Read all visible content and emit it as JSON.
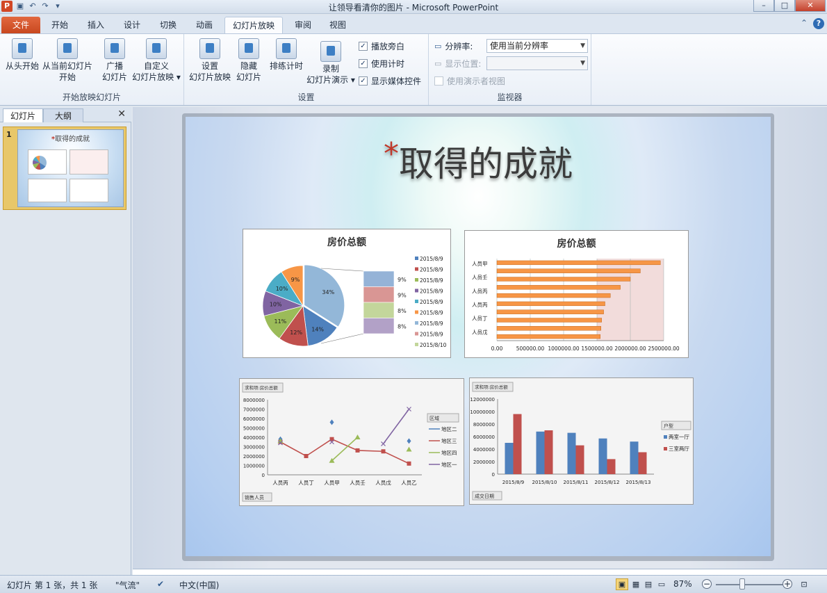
{
  "window": {
    "title": "让领导看清你的图片 - Microsoft PowerPoint"
  },
  "tabs": [
    "文件",
    "开始",
    "插入",
    "设计",
    "切换",
    "动画",
    "幻灯片放映",
    "审阅",
    "视图"
  ],
  "ribbon": {
    "group1": {
      "label": "开始放映幻灯片",
      "from_start": "从头开始",
      "from_current_1": "从当前幻灯片",
      "from_current_2": "开始",
      "broadcast_1": "广播",
      "broadcast_2": "幻灯片",
      "custom_1": "自定义",
      "custom_2": "幻灯片放映"
    },
    "group2": {
      "label": "设置",
      "setup_1": "设置",
      "setup_2": "幻灯片放映",
      "hide_1": "隐藏",
      "hide_2": "幻灯片",
      "rehearse": "排练计时",
      "record_1": "录制",
      "record_2": "幻灯片演示",
      "play_narration": "播放旁白",
      "use_timings": "使用计时",
      "show_media": "显示媒体控件"
    },
    "group3": {
      "label": "监视器",
      "resolution_label": "分辨率:",
      "resolution_value": "使用当前分辨率",
      "show_on_label": "显示位置:",
      "presenter_view": "使用演示者视图"
    }
  },
  "leftpane": {
    "tab_slides": "幻灯片",
    "tab_outline": "大纲",
    "thumb_number": "1",
    "thumb_title": "取得的成就"
  },
  "slide": {
    "title": "取得的成就",
    "asterisk": "*"
  },
  "chart_data": [
    {
      "type": "pie",
      "title": "房价总额",
      "slices": [
        {
          "label": "34%",
          "value": 34
        },
        {
          "label": "14%",
          "value": 14
        },
        {
          "label": "12%",
          "value": 12
        },
        {
          "label": "11%",
          "value": 11
        },
        {
          "label": "10%",
          "value": 10
        },
        {
          "label": "10%",
          "value": 10
        },
        {
          "label": "9%",
          "value": 9
        }
      ],
      "sub_bar": [
        "9%",
        "9%",
        "8%",
        "8%"
      ],
      "legend": [
        "2015/8/9",
        "2015/8/9",
        "2015/8/9",
        "2015/8/9",
        "2015/8/9",
        "2015/8/9",
        "2015/8/9",
        "2015/8/9",
        "2015/8/10"
      ],
      "colors": [
        "#4f81bd",
        "#c0504d",
        "#9bbb59",
        "#8064a2",
        "#4bacc6",
        "#f79646",
        "#93b7d8",
        "#d99694",
        "#c3d69b"
      ]
    },
    {
      "type": "bar",
      "title": "房价总额",
      "categories": [
        "人员甲",
        "人员壬",
        "人员丙",
        "人员丙",
        "人员丁",
        "人员戊"
      ],
      "values": [
        1550000,
        1560000,
        1570000,
        1600000,
        1620000,
        1700000,
        1850000,
        2000000,
        2150000,
        2450000
      ],
      "xticks": [
        "0.00",
        "500000.00",
        "1000000.00",
        "1500000.00",
        "2000000.00",
        "2500000.00"
      ],
      "xlim": [
        0,
        2500000
      ]
    },
    {
      "type": "line",
      "field_label": "求和项:房价总额",
      "categories": [
        "人员丙",
        "人员丁",
        "人员甲",
        "人员壬",
        "人员戊",
        "人员乙"
      ],
      "yticks": [
        "0",
        "1000000",
        "2000000",
        "3000000",
        "4000000",
        "5000000",
        "6000000",
        "7000000",
        "8000000"
      ],
      "ylim": [
        0,
        8000000
      ],
      "legend_title": "区域",
      "series": [
        {
          "name": "地区二",
          "values": [
            3800000,
            null,
            5600000,
            null,
            null,
            3600000
          ]
        },
        {
          "name": "地区三",
          "values": [
            3500000,
            2000000,
            3800000,
            2600000,
            2500000,
            1200000
          ]
        },
        {
          "name": "地区四",
          "values": [
            3600000,
            null,
            1500000,
            4000000,
            null,
            2700000
          ]
        },
        {
          "name": "地区一",
          "values": [
            3400000,
            null,
            3500000,
            null,
            3300000,
            7000000
          ]
        }
      ],
      "filter_label": "销售人员"
    },
    {
      "type": "bar",
      "field_label": "求和项:房价总额",
      "categories": [
        "2015/8/9",
        "2015/8/10",
        "2015/8/11",
        "2015/8/12",
        "2015/8/13"
      ],
      "yticks": [
        "0",
        "2000000",
        "4000000",
        "6000000",
        "8000000",
        "10000000",
        "12000000"
      ],
      "ylim": [
        0,
        12000000
      ],
      "legend_title": "户型",
      "series": [
        {
          "name": "两室一厅",
          "values": [
            5000000,
            6800000,
            6600000,
            5700000,
            5200000
          ]
        },
        {
          "name": "三室两厅",
          "values": [
            9600000,
            7000000,
            4600000,
            2400000,
            3500000
          ]
        }
      ],
      "filter_label": "成交日期"
    }
  ],
  "status": {
    "slide_info": "幻灯片 第 1 张，共 1 张",
    "theme": "\"气流\"",
    "language": "中文(中国)",
    "zoom": "87%"
  }
}
